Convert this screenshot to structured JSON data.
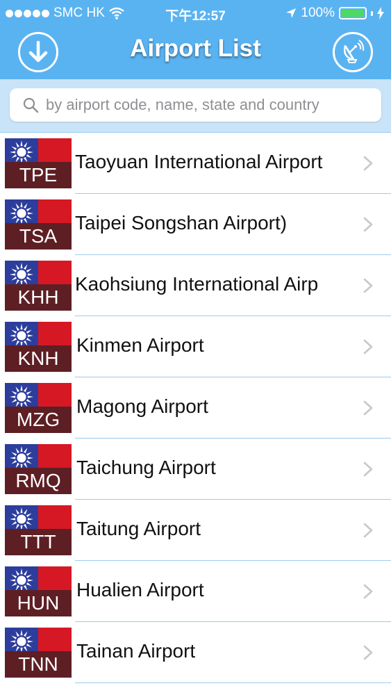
{
  "status_bar": {
    "carrier": "SMC HK",
    "time": "下午12:57",
    "battery": "100%"
  },
  "nav": {
    "title": "Airport List",
    "left_button_icon": "download-arrow-icon",
    "right_button_icon": "satellite-dish-icon"
  },
  "search": {
    "placeholder": "by airport code, name, state and country",
    "value": ""
  },
  "airports": [
    {
      "code": "TPE",
      "name": "Taoyuan International Airport",
      "truncated_left": true
    },
    {
      "code": "TSA",
      "name": "Taipei Songshan Airport)",
      "truncated_left": true
    },
    {
      "code": "KHH",
      "name": "Kaohsiung International Airp",
      "truncated_left": true
    },
    {
      "code": "KNH",
      "name": "Kinmen Airport",
      "truncated_left": false
    },
    {
      "code": "MZG",
      "name": "Magong Airport",
      "truncated_left": false
    },
    {
      "code": "RMQ",
      "name": "Taichung Airport",
      "truncated_left": false
    },
    {
      "code": "TTT",
      "name": "Taitung Airport",
      "truncated_left": false
    },
    {
      "code": "HUN",
      "name": "Hualien Airport",
      "truncated_left": false
    },
    {
      "code": "TNN",
      "name": "Tainan Airport",
      "truncated_left": false
    }
  ],
  "colors": {
    "nav_blue": "#5ab3f1",
    "search_bg": "#c9e4f8",
    "separator": "#9bcbef",
    "flag_red": "#d61825",
    "flag_blue": "#2d3d9c",
    "code_bg": "#5d1f24",
    "battery_green": "#4cd964"
  }
}
